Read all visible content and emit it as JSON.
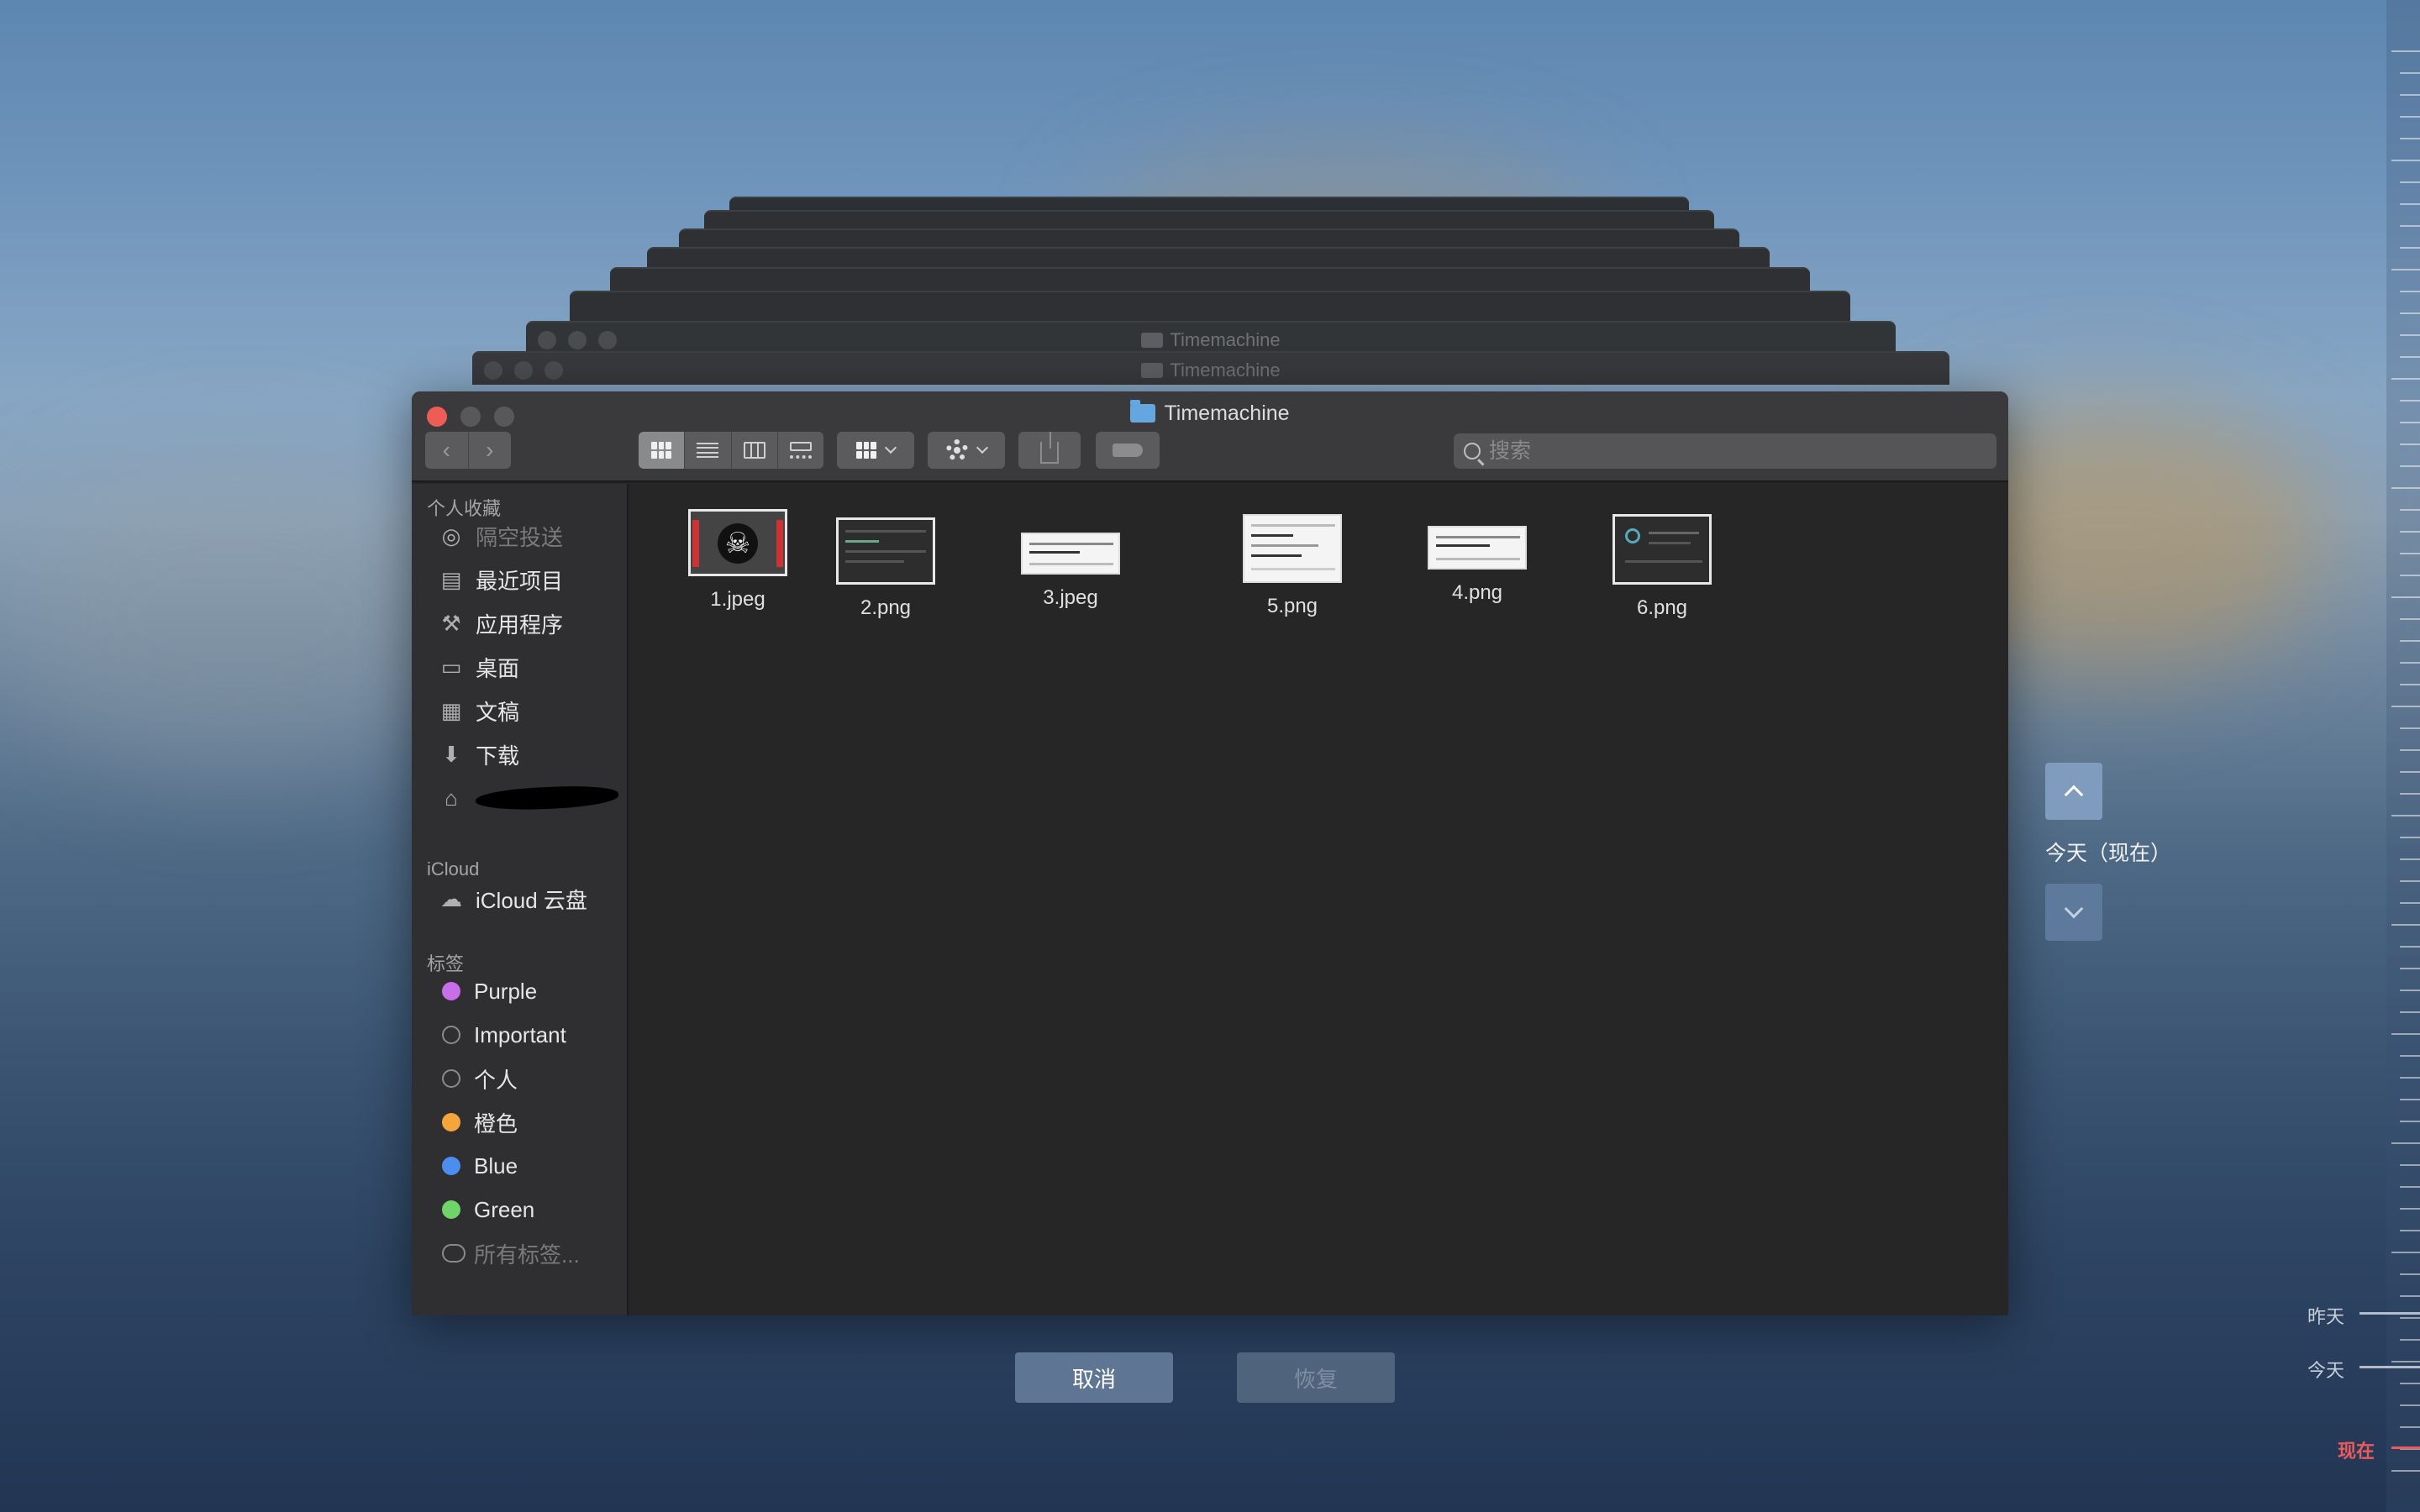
{
  "window": {
    "title": "Timemachine",
    "back_titles": [
      "Timemachine",
      "Timemachine"
    ]
  },
  "toolbar": {
    "back_icon": "chevron-left-icon",
    "forward_icon": "chevron-right-icon",
    "search_placeholder": "搜索"
  },
  "sidebar": {
    "favorites_header": "个人收藏",
    "favorites": [
      {
        "label": "隔空投送",
        "icon": "airdrop-icon",
        "disabled": true
      },
      {
        "label": "最近项目",
        "icon": "recents-icon"
      },
      {
        "label": "应用程序",
        "icon": "applications-icon"
      },
      {
        "label": "桌面",
        "icon": "desktop-icon"
      },
      {
        "label": "文稿",
        "icon": "documents-icon"
      },
      {
        "label": "下载",
        "icon": "downloads-icon"
      },
      {
        "label": "",
        "icon": "home-icon"
      }
    ],
    "icloud_header": "iCloud",
    "icloud": [
      {
        "label": "iCloud 云盘",
        "icon": "cloud-icon"
      }
    ],
    "tags_header": "标签",
    "tags": [
      {
        "label": "Purple",
        "color": "#c86ee8"
      },
      {
        "label": "Important",
        "color": ""
      },
      {
        "label": "个人",
        "color": ""
      },
      {
        "label": "橙色",
        "color": "#f6a53c"
      },
      {
        "label": "Blue",
        "color": "#4c8df0"
      },
      {
        "label": "Green",
        "color": "#6fd46a"
      },
      {
        "label": "所有标签...",
        "color": "multi"
      }
    ]
  },
  "files": [
    {
      "name": "1.jpeg"
    },
    {
      "name": "2.png"
    },
    {
      "name": "3.jpeg"
    },
    {
      "name": "5.png"
    },
    {
      "name": "4.png"
    },
    {
      "name": "6.png"
    }
  ],
  "actions": {
    "cancel": "取消",
    "restore": "恢复"
  },
  "timemachine": {
    "current_label": "今天（现在）",
    "timeline": {
      "yesterday": "昨天",
      "today": "今天",
      "now": "现在"
    },
    "accent_now": "#ec5b5b"
  }
}
